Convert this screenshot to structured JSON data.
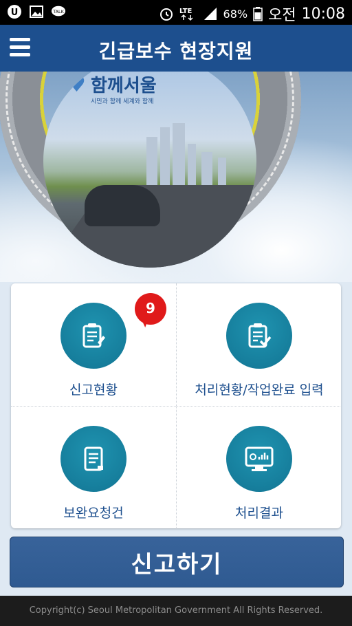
{
  "status_bar": {
    "battery": "68%",
    "period": "오전",
    "time": "10:08",
    "network": "LTE",
    "icons": [
      "u-plus-icon",
      "image-icon",
      "kakaotalk-icon",
      "alarm-icon",
      "lte-icon",
      "signal-icon",
      "battery-icon"
    ]
  },
  "app_bar": {
    "title": "긴급보수 현장지원",
    "color": "#1d4f8e"
  },
  "hero": {
    "logo_text": "함께서울",
    "logo_subtitle": "시민과 함께 세계와 함께"
  },
  "menu": {
    "items": [
      {
        "label": "신고현황",
        "icon": "report-status-icon",
        "badge": "9"
      },
      {
        "label": "처리현황/작업완료 입력",
        "icon": "process-status-icon"
      },
      {
        "label": "보완요청건",
        "icon": "supplement-request-icon"
      },
      {
        "label": "처리결과",
        "icon": "result-monitor-icon"
      }
    ]
  },
  "report_button": {
    "label": "신고하기"
  },
  "footer": {
    "copyright": "Copyright(c) Seoul Metropolitan Government All Rights Reserved."
  },
  "colors": {
    "primary": "#1d4f8e",
    "teal": "#167e9c",
    "badge": "#e01a1a"
  }
}
